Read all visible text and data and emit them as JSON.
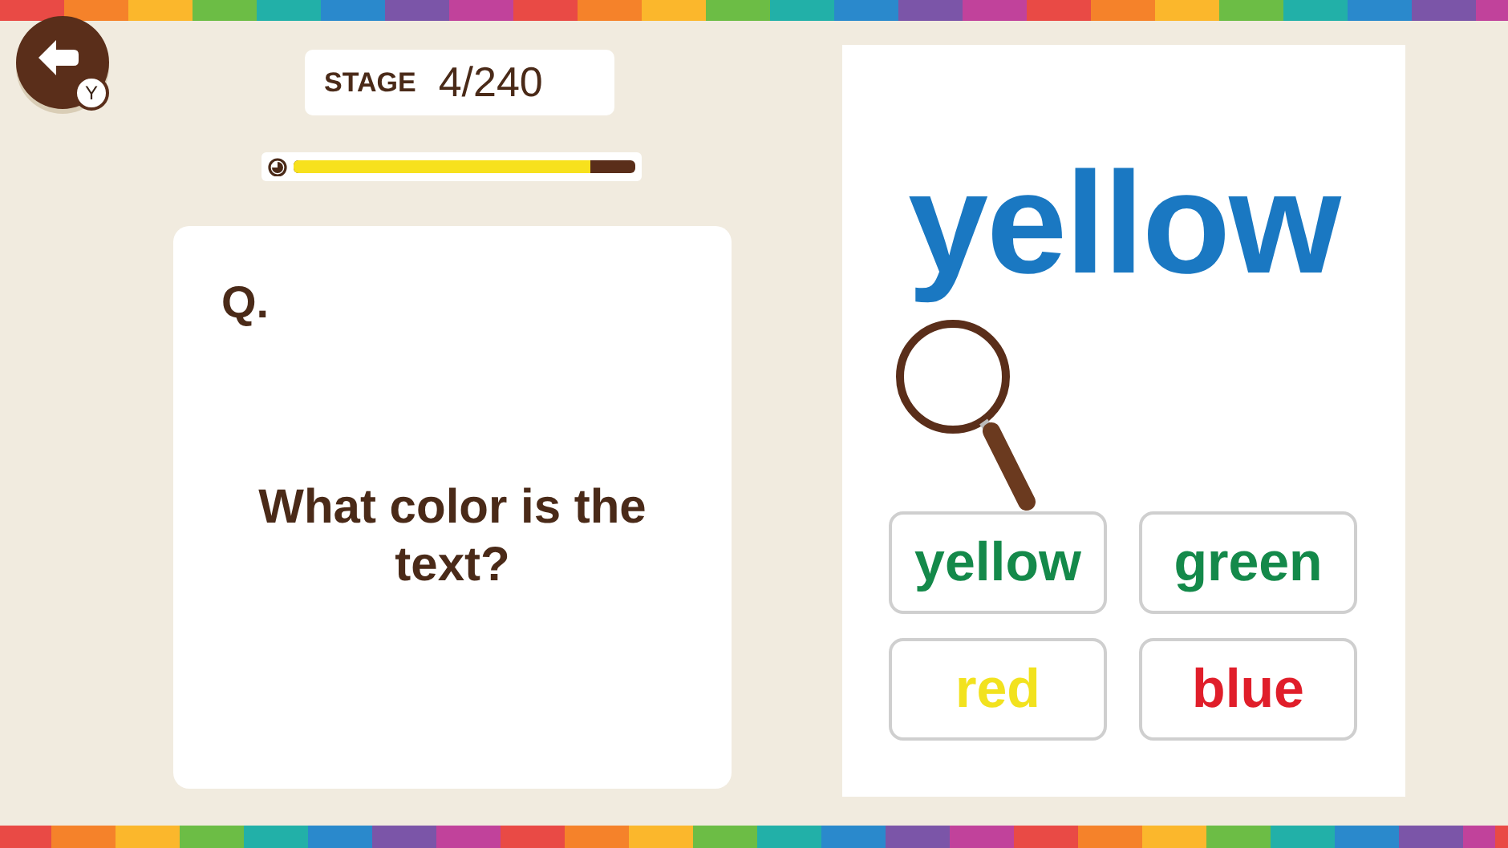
{
  "back_button": {
    "badge": "Y"
  },
  "stage": {
    "label": "STAGE",
    "value": "4/240"
  },
  "timer": {
    "level": 0.87
  },
  "question": {
    "marker": "Q.",
    "text": "What color is the text?"
  },
  "word": {
    "text": "yellow",
    "color": "#1a78c2"
  },
  "answers": [
    {
      "label": "yellow",
      "color": "#14894a"
    },
    {
      "label": "green",
      "color": "#14894a"
    },
    {
      "label": "red",
      "color": "#f2e21e"
    },
    {
      "label": "blue",
      "color": "#e01e2a"
    }
  ]
}
